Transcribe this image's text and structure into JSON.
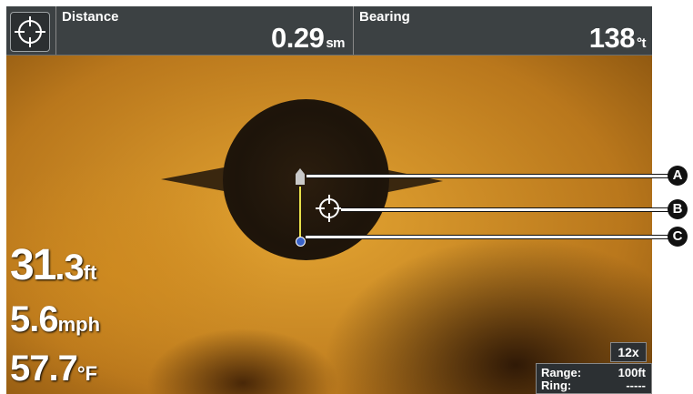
{
  "header": {
    "distance": {
      "label": "Distance",
      "value": "0.29",
      "unit": "sm"
    },
    "bearing": {
      "label": "Bearing",
      "value": "138",
      "unit": "°t"
    }
  },
  "callouts": [
    "A",
    "B",
    "C"
  ],
  "readouts": {
    "depth": {
      "value": "31",
      "decimal": ".3",
      "unit": "ft"
    },
    "speed": {
      "value": "5",
      "decimal": ".6",
      "unit": "mph"
    },
    "temperature": {
      "value": "57",
      "decimal": ".7",
      "unit": "°F"
    }
  },
  "zoom": "12x",
  "range": {
    "label": "Range:",
    "value": "100ft"
  },
  "ring": {
    "label": "Ring:",
    "value": "-----"
  },
  "colors": {
    "sonar": "#d99a2b",
    "bar": "#3c4143",
    "track": "#e8e04a",
    "marker": "#3a63c9"
  },
  "icons": {
    "cursor": "crosshair-icon",
    "boat": "boat-icon",
    "waypoint": "waypoint-icon"
  }
}
